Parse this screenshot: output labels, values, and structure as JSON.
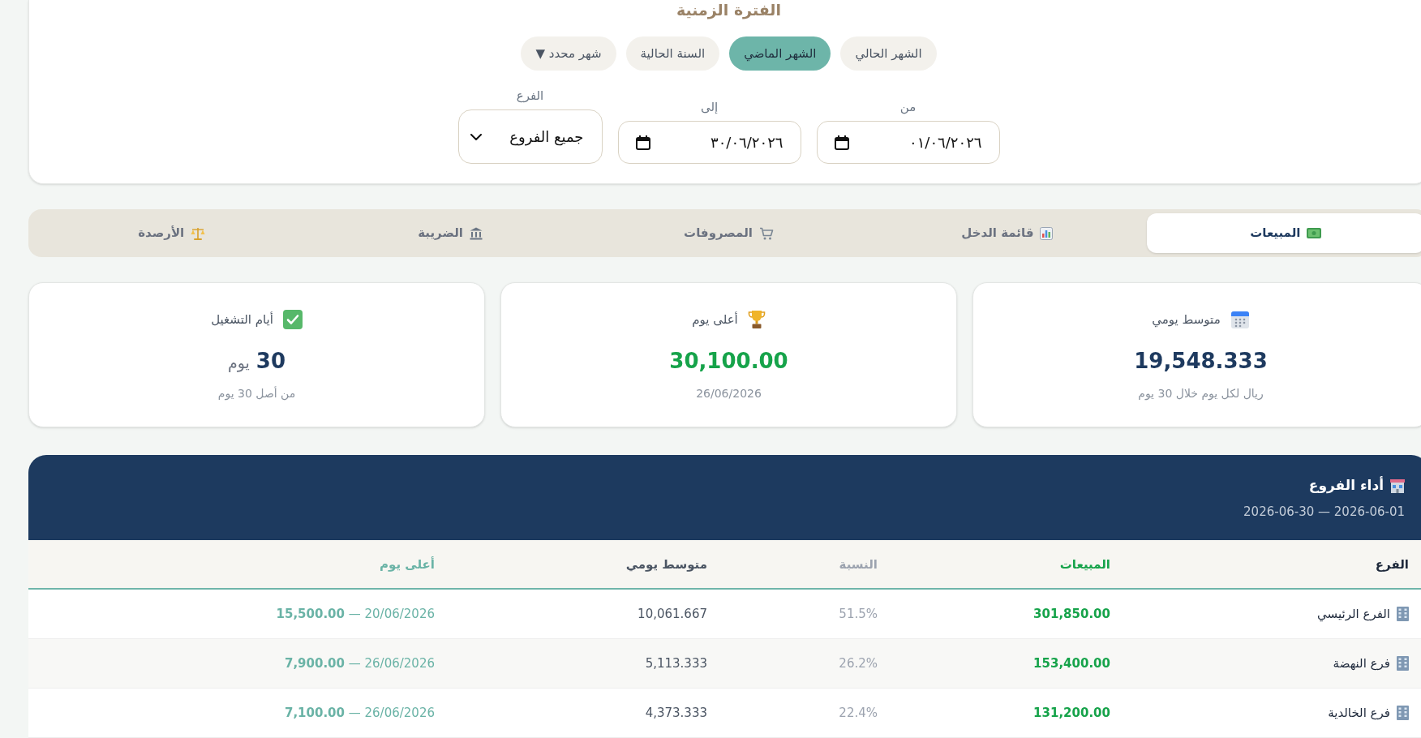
{
  "filter_panel": {
    "title": "الفترة الزمنية",
    "presets": [
      {
        "label": "الشهر الحالي",
        "selected": false
      },
      {
        "label": "الشهر الماضي",
        "selected": true
      },
      {
        "label": "السنة الحالية",
        "selected": false
      },
      {
        "label": "شهر محدد ▼",
        "selected": false
      }
    ],
    "fields": [
      {
        "kind": "date",
        "label": "من",
        "value": "٠١/٠٦/٢٠٢٦"
      },
      {
        "kind": "date",
        "label": "إلى",
        "value": "٣٠/٠٦/٢٠٢٦"
      },
      {
        "kind": "select",
        "label": "الفرع",
        "value": "جميع الفروع"
      }
    ]
  },
  "tabs": [
    {
      "label": "المبيعات",
      "selected": true
    },
    {
      "label": "قائمة الدخل",
      "selected": false
    },
    {
      "label": "المصروفات",
      "selected": false
    },
    {
      "label": "الضريبة",
      "selected": false
    },
    {
      "label": "الأرصدة",
      "selected": false
    }
  ],
  "stats": [
    {
      "kind": "average",
      "label": "متوسط يومي",
      "value": "19,548.333",
      "note": "ريال لكل يوم خلال 30 يوم"
    },
    {
      "kind": "peak",
      "label": "أعلى يوم",
      "value": "30,100.00",
      "note": "26/06/2026"
    },
    {
      "kind": "count",
      "label": "أيام التشغيل",
      "value": "30",
      "unit": "يوم",
      "note": "من أصل 30 يوم"
    }
  ],
  "branch_performance": {
    "title": "أداء الفروع",
    "period": "2026-06-01 — 2026-06-30",
    "columns": [
      "الفرع",
      "المبيعات",
      "النسبة",
      "متوسط يومي",
      "أعلى يوم"
    ],
    "rows": [
      {
        "cells": [
          "الفرع الرئيسي",
          "301,850.00",
          "51.5%",
          "10,061.667",
          "20/06/2026 — **15,500.00**"
        ]
      },
      {
        "cells": [
          "فرع النهضة",
          "153,400.00",
          "26.2%",
          "5,113.333",
          "26/06/2026 — **7,900.00**"
        ]
      },
      {
        "cells": [
          "فرع الخالدية",
          "131,200.00",
          "22.4%",
          "4,373.333",
          "26/06/2026 — **7,100.00**"
        ]
      }
    ]
  }
}
